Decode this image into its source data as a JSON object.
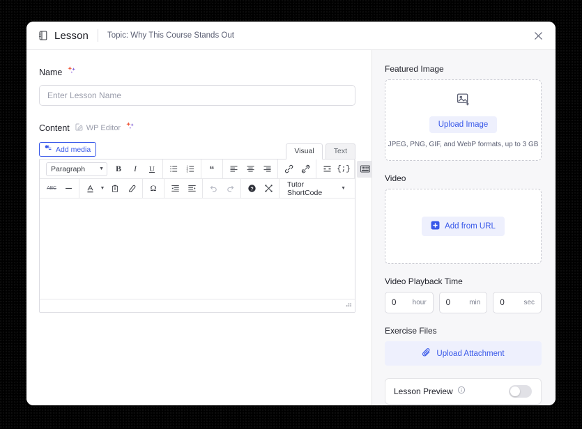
{
  "header": {
    "icon": "notebook-icon",
    "title": "Lesson",
    "subtitle": "Topic: Why This Course Stands Out",
    "close_icon": "close-icon"
  },
  "left": {
    "name": {
      "label": "Name",
      "ai_icon": "ai-sparkle-icon",
      "placeholder": "Enter Lesson Name",
      "value": ""
    },
    "content": {
      "label": "Content",
      "wp_editor_label": "WP Editor",
      "wp_editor_icon": "pencil-square-icon",
      "ai_icon": "ai-sparkle-icon"
    },
    "editor": {
      "add_media_label": "Add media",
      "add_media_icon": "media-icon",
      "tabs": [
        {
          "label": "Visual",
          "active": true
        },
        {
          "label": "Text",
          "active": false
        }
      ],
      "paragraph_select": "Paragraph",
      "shortcode_label": "Tutor ShortCode",
      "body_text": "",
      "toolbar_row1": [
        "bold-icon",
        "italic-icon",
        "underline-icon",
        "bulleted-list-icon",
        "numbered-list-icon",
        "blockquote-icon",
        "align-left-icon",
        "align-center-icon",
        "align-right-icon",
        "link-icon",
        "unlink-icon",
        "read-more-icon",
        "shortcode-icon",
        "toolbar-toggle-icon"
      ],
      "toolbar_row2": [
        "strikethrough-icon",
        "horizontal-rule-icon",
        "text-color-icon",
        "paste-as-text-icon",
        "clear-formatting-icon",
        "special-character-icon",
        "outdent-icon",
        "indent-icon",
        "undo-icon",
        "redo-icon",
        "help-icon",
        "fullscreen-icon"
      ]
    }
  },
  "right": {
    "featured_image": {
      "label": "Featured Image",
      "icon": "image-add-icon",
      "button_label": "Upload Image",
      "hint": "JPEG, PNG, GIF, and WebP formats, up to 3 GB"
    },
    "video": {
      "label": "Video",
      "button_label": "Add from URL",
      "button_icon": "plus-square-icon"
    },
    "playback_time": {
      "label": "Video Playback Time",
      "fields": [
        {
          "value": "0",
          "unit": "hour"
        },
        {
          "value": "0",
          "unit": "min"
        },
        {
          "value": "0",
          "unit": "sec"
        }
      ]
    },
    "exercise_files": {
      "label": "Exercise Files",
      "button_label": "Upload Attachment",
      "button_icon": "paperclip-icon"
    },
    "lesson_preview": {
      "label": "Lesson Preview",
      "info_icon": "info-icon",
      "toggle_on": false
    }
  },
  "colors": {
    "accent": "#3858e9",
    "accent_soft": "#eef0fd",
    "panel_bg": "#f7f7f9",
    "border": "#dcdce2",
    "text": "#23242d",
    "muted": "#5b5f73"
  }
}
